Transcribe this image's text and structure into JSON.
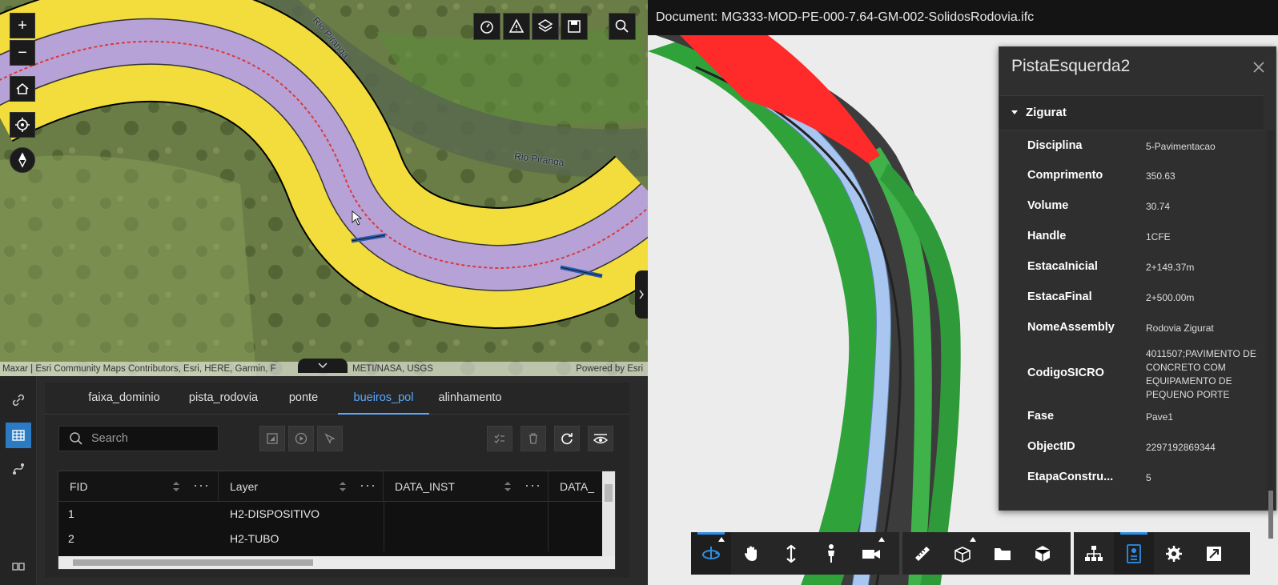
{
  "map": {
    "zoom_in_label": "+",
    "zoom_out_label": "−",
    "river_labels": [
      "Rio Piranga",
      "Rio Piranga"
    ],
    "attribution": "Maxar | Esri Community Maps Contributors, Esri, HERE, Garmin, F",
    "attribution_tail": "METI/NASA, USGS",
    "powered_by": "Powered by Esri",
    "toolbar_icons": [
      "measure-distance-icon",
      "measure-area-icon",
      "layers-icon",
      "save-icon",
      "search-icon"
    ]
  },
  "attribute_table": {
    "tabs": [
      {
        "label": "faixa_dominio",
        "active": false
      },
      {
        "label": "pista_rodovia",
        "active": false
      },
      {
        "label": "ponte",
        "active": false
      },
      {
        "label": "bueiros_pol",
        "active": true
      },
      {
        "label": "alinhamento",
        "active": false
      }
    ],
    "search_placeholder": "Search",
    "columns": [
      "FID",
      "Layer",
      "DATA_INST",
      "DATA_"
    ],
    "rows": [
      {
        "fid": "1",
        "layer": "H2-DISPOSITIVO",
        "data_inst": ""
      },
      {
        "fid": "2",
        "layer": "H2-TUBO",
        "data_inst": ""
      }
    ]
  },
  "viewer": {
    "document_title": "Document: MG333-MOD-PE-000-7.64-GM-002-SolidosRodovia.ifc",
    "properties_panel": {
      "title": "PistaEsquerda2",
      "section": "Zigurat",
      "properties": [
        {
          "key": "Disciplina",
          "value": "5-Pavimentacao"
        },
        {
          "key": "Comprimento",
          "value": "350.63"
        },
        {
          "key": "Volume",
          "value": "30.74"
        },
        {
          "key": "Handle",
          "value": "1CFE"
        },
        {
          "key": "EstacaInicial",
          "value": "2+149.37m"
        },
        {
          "key": "EstacaFinal",
          "value": "2+500.00m"
        },
        {
          "key": "NomeAssembly",
          "value": "Rodovia Zigurat"
        },
        {
          "key": "CodigoSICRO",
          "value": "4011507;PAVIMENTO DE CONCRETO COM EQUIPAMENTO DE PEQUENO PORTE"
        },
        {
          "key": "Fase",
          "value": "Pave1"
        },
        {
          "key": "ObjectID",
          "value": "2297192869344"
        },
        {
          "key": "EtapaConstru...",
          "value": "5"
        }
      ]
    },
    "toolbar_groups": [
      [
        "orbit-icon",
        "pan-icon",
        "zoom-icon",
        "first-person-icon",
        "camera-icon"
      ],
      [
        "measure-icon",
        "section-icon",
        "explode-icon",
        "object-icon"
      ],
      [
        "model-browser-icon",
        "properties-icon",
        "settings-icon",
        "fullscreen-icon"
      ]
    ],
    "colors": {
      "selected_red": "#ff2a2a",
      "lane_blue": "#a9c6f0",
      "shoulder_green": "#2fa33a",
      "asphalt": "#3c3c3c",
      "accent_blue": "#2e8ee6"
    }
  },
  "colors": {
    "faixa_dominio_yellow": "#f2dd3c",
    "pista_lilac": "#b7a2d8",
    "alignment_red": "#d83a3a",
    "tab_active_blue": "#5aa9ff"
  }
}
